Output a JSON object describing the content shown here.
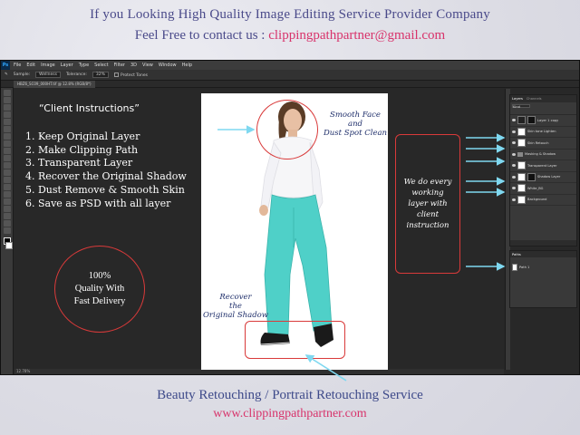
{
  "header": {
    "line1": "If you Looking High Quality Image Editing Service Provider Company",
    "line2_prefix": "Feel Free to contact us : ",
    "email": "clippingpathpartner@gmail.com"
  },
  "footer": {
    "line1": "Beauty Retouching / Portrait Retouching Service",
    "website": "www.clippingpathpartner.com"
  },
  "photoshop": {
    "logo": "Ps",
    "menu": [
      "File",
      "Edit",
      "Image",
      "Layer",
      "Type",
      "Select",
      "Filter",
      "3D",
      "View",
      "Window",
      "Help"
    ],
    "options": {
      "sample_label": "Sample:",
      "sample_value": "Wellness",
      "tolerance_label": "Tolerance:",
      "tolerance_value": "32%",
      "contiguous": "Protect Tones"
    },
    "doc_tab": "HBZ6_SC09_000HT.tif @ 12.8% (RGB/8*)",
    "status": "12.78%",
    "layers_panel": {
      "tabs": [
        "Layers",
        "Channels"
      ],
      "kind": "Kind",
      "layers": [
        {
          "name": "Layer 1 copy"
        },
        {
          "name": "Skin tone Lighten"
        },
        {
          "name": "Skin Retouch"
        },
        {
          "name": "Masking & Shadow"
        },
        {
          "name": "Transparent Layer"
        },
        {
          "name": "Shadow Layer"
        },
        {
          "name": "White_BG"
        },
        {
          "name": "Background"
        }
      ]
    },
    "paths_panel": {
      "tabs": [
        "Paths"
      ],
      "paths": [
        {
          "name": "Path 1"
        }
      ]
    }
  },
  "instructions": {
    "title": "“Client Instructions”",
    "items": [
      "1. Keep Original Layer",
      "2. Make Clipping Path",
      "3. Transparent Layer",
      "4. Recover the Original Shadow",
      "5. Dust Remove &  Smooth Skin",
      "6. Save as PSD with all layer"
    ]
  },
  "quality_badge": {
    "line1": "100%",
    "line2": "Quality With",
    "line3": "Fast Delivery"
  },
  "notes": {
    "smooth_face": [
      "Smooth Face",
      "and",
      "Dust Spot Clean"
    ],
    "recover_shadow": [
      "Recover",
      "the",
      "Original Shadow"
    ],
    "layers_note": "We do every working layer with client instruction"
  },
  "colors": {
    "accent_red": "#d93a3a",
    "arrow_cyan": "#7fd8f0",
    "email_pink": "#d8336b",
    "header_blue": "#4a4a8a"
  }
}
